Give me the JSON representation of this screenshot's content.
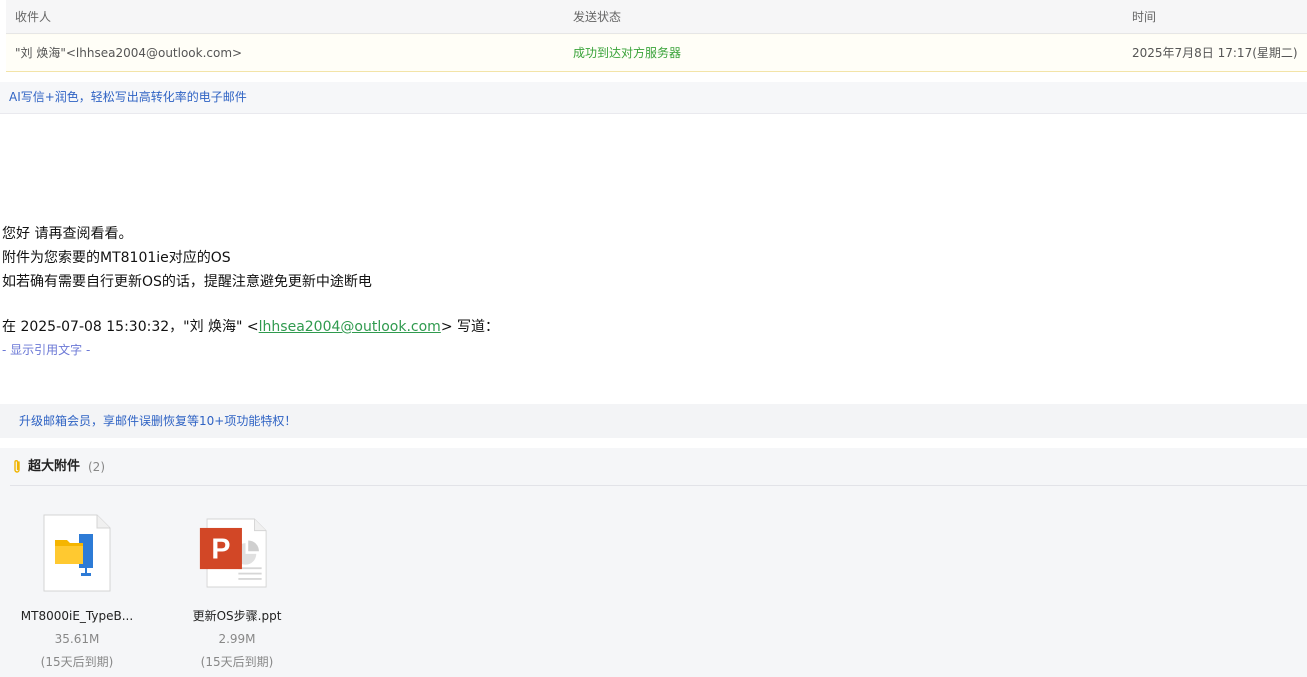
{
  "status_table": {
    "headers": {
      "recipient": "收件人",
      "status": "发送状态",
      "time": "时间"
    },
    "rows": [
      {
        "recipient": "\"刘 焕海\"<lhhsea2004@outlook.com>",
        "status": "成功到达对方服务器",
        "time": "2025年7月8日 17:17(星期二)"
      }
    ]
  },
  "ai_banner": {
    "label": "AI写信+润色，轻松写出高转化率的电子邮件"
  },
  "mail_body": {
    "lines": [
      "您好 请再查阅看看。",
      "附件为您索要的MT8101ie对应的OS",
      "如若确有需要自行更新OS的话，提醒注意避免更新中途断电"
    ],
    "quote_prefix": "在 2025-07-08 15:30:32，\"刘 焕海\" <",
    "quote_email": "lhhsea2004@outlook.com",
    "quote_suffix": "> 写道：",
    "show_quote": "- 显示引用文字 -"
  },
  "upgrade_banner": {
    "label": "升级邮箱会员，享邮件误删恢复等10+项功能特权！"
  },
  "attachments": {
    "title": "超大附件",
    "count": "(2)",
    "items": [
      {
        "name": "MT8000iE_TypeB...",
        "size": "35.61M",
        "expiry": "(15天后到期)",
        "icon": "archive-file-icon"
      },
      {
        "name": "更新OS步骤.ppt",
        "size": "2.99M",
        "expiry": "(15天后到期)",
        "icon": "ppt-file-icon"
      }
    ]
  },
  "colors": {
    "success": "#3aa33a",
    "link": "#2f63c4",
    "email_link": "#2f9a4e",
    "show_quote": "#6b78d6",
    "ppt_red": "#d24726",
    "folder_yellow": "#f5b500",
    "archive_blue": "#2d7bd6"
  }
}
